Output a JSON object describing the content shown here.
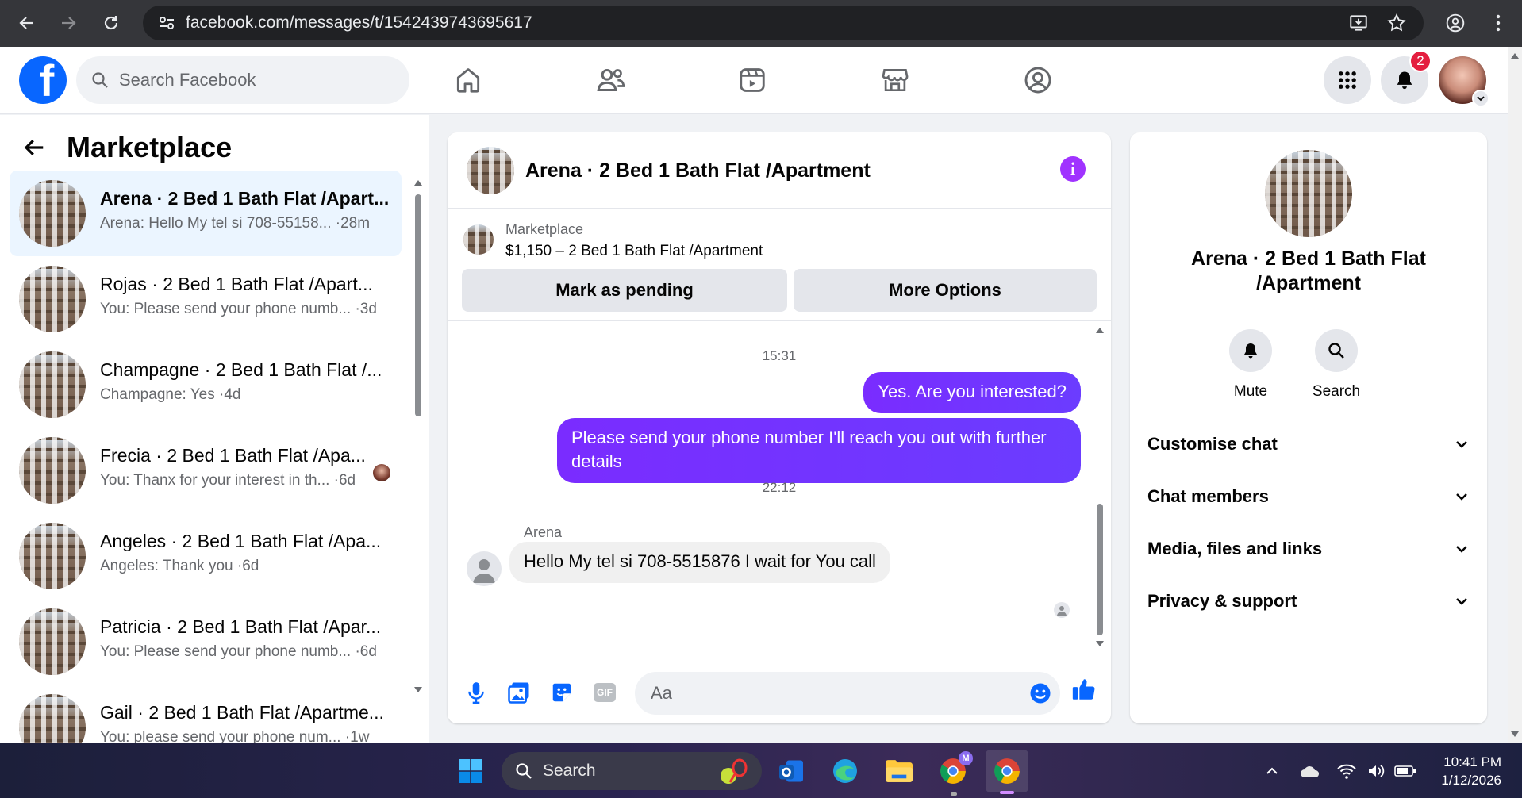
{
  "browser": {
    "url": "facebook.com/messages/t/1542439743695617"
  },
  "fb_nav": {
    "search_placeholder": "Search Facebook",
    "notification_count": "2"
  },
  "left_panel": {
    "title": "Marketplace",
    "conversations": [
      {
        "name": "Arena · 2 Bed 1 Bath Flat /Apart...",
        "snippet": "Arena: Hello My tel si 708-55158... ·28m",
        "active": true
      },
      {
        "name": "Rojas · 2 Bed 1 Bath Flat /Apart...",
        "snippet": "You: Please send your phone numb... ·3d",
        "active": false
      },
      {
        "name": "Champagne · 2 Bed 1 Bath Flat /...",
        "snippet": "Champagne: Yes ·4d",
        "active": false
      },
      {
        "name": "Frecia · 2 Bed 1 Bath Flat /Apa...",
        "snippet": "You: Thanx for your interest in th... ·6d",
        "active": false
      },
      {
        "name": "Angeles · 2 Bed 1 Bath Flat /Apa...",
        "snippet": "Angeles: Thank you ·6d",
        "active": false
      },
      {
        "name": "Patricia · 2 Bed 1 Bath Flat /Apar...",
        "snippet": "You: Please send your phone numb... ·6d",
        "active": false
      },
      {
        "name": "Gail · 2 Bed 1 Bath Flat /Apartme...",
        "snippet": "You: please send your phone num... ·1w",
        "active": false
      }
    ]
  },
  "chat": {
    "title": "Arena · 2 Bed 1 Bath Flat /Apartment",
    "listing_label": "Marketplace",
    "listing_price": "$1,150 – 2 Bed 1 Bath Flat /Apartment",
    "mark_pending": "Mark as pending",
    "more_options": "More Options",
    "time1": "15:31",
    "out_msg1": "Yes. Are you interested?",
    "out_msg2_line1": "Please send your phone number  I'll reach you out with further",
    "out_msg2_line2": "details",
    "time2": "22:12",
    "sender": "Arena",
    "in_msg": "Hello My  tel si 708-5515876 I wait for You call",
    "input_placeholder": "Aa"
  },
  "info_panel": {
    "title_line1": "Arena · 2 Bed 1 Bath Flat",
    "title_line2": "/Apartment",
    "mute": "Mute",
    "search": "Search",
    "rows": [
      "Customise chat",
      "Chat members",
      "Media, files and links",
      "Privacy & support"
    ]
  },
  "taskbar": {
    "search": "Search",
    "time": "10:41 PM",
    "date": "1/12/2026"
  },
  "colors": {
    "fb_blue": "#0866ff",
    "messenger_purple": "#7a2cff",
    "notification_red": "#e41e3f"
  }
}
